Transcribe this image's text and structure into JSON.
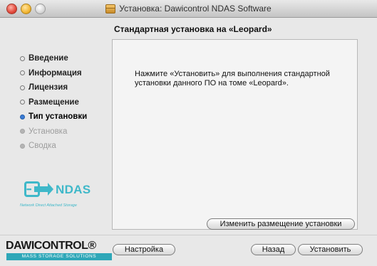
{
  "window": {
    "title": "Установка: Dawicontrol NDAS Software"
  },
  "heading": "Стандартная установка на «Leopard»",
  "steps": [
    {
      "label": "Введение",
      "state": "done"
    },
    {
      "label": "Информация",
      "state": "done"
    },
    {
      "label": "Лицензия",
      "state": "done"
    },
    {
      "label": "Размещение",
      "state": "done"
    },
    {
      "label": "Тип установки",
      "state": "current"
    },
    {
      "label": "Установка",
      "state": "future"
    },
    {
      "label": "Сводка",
      "state": "future"
    }
  ],
  "ndas_logo": {
    "text": "NDAS",
    "dots": "•••",
    "tagline": "Network Direct Attached Storage"
  },
  "content": {
    "message": "Нажмите «Установить» для выполнения стандартной установки данного ПО на томе «Leopard».",
    "change_location_label": "Изменить размещение установки"
  },
  "dawicontrol_logo": {
    "name": "DAWICONTROL®",
    "tagline": "MASS STORAGE SOLUTIONS"
  },
  "buttons": {
    "settings": "Настройка",
    "back": "Назад",
    "install": "Установить"
  }
}
